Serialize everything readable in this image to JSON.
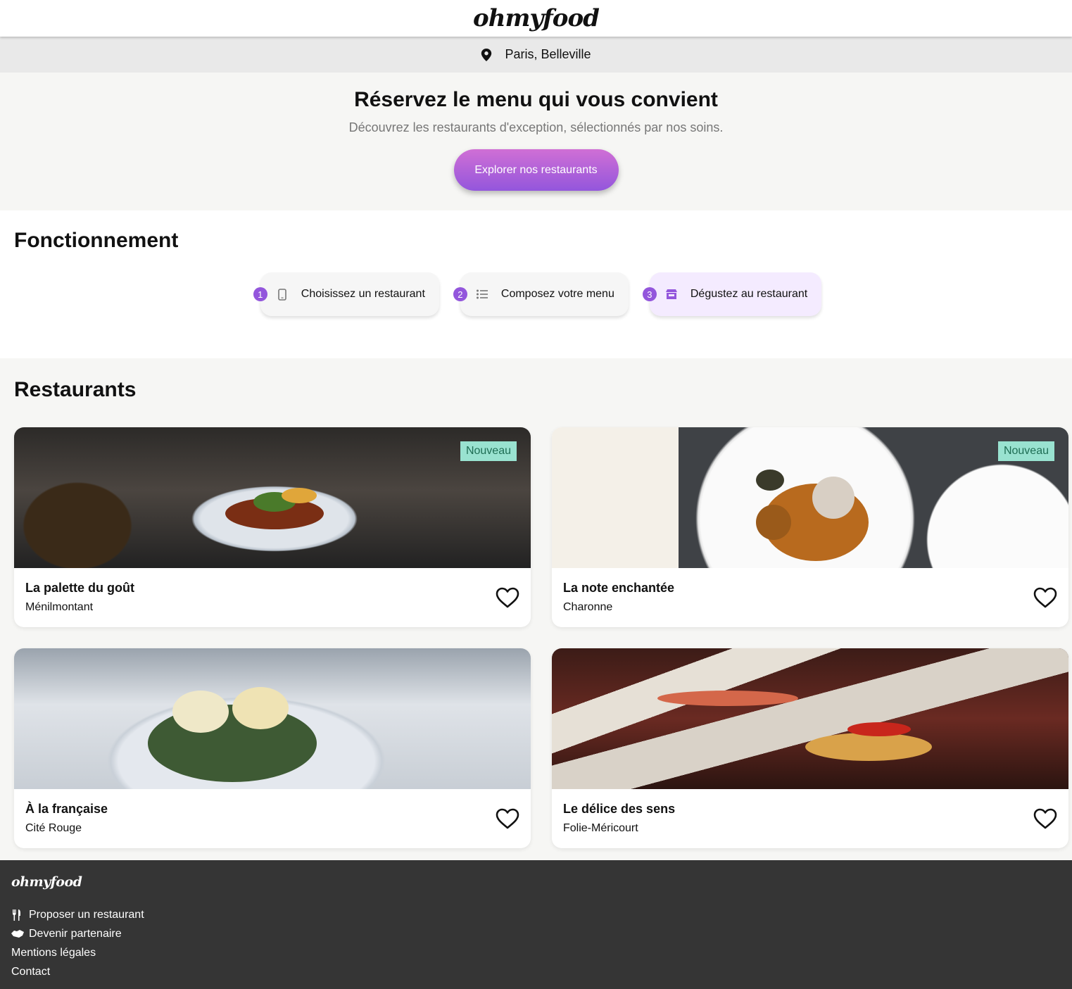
{
  "header": {
    "logo": "ohmyfood"
  },
  "location": {
    "icon": "map-pin-icon",
    "label": "Paris, Belleville"
  },
  "hero": {
    "title": "Réservez le menu qui vous convient",
    "subtitle": "Découvrez les restaurants d'exception, sélectionnés par nos soins.",
    "cta_label": "Explorer nos restaurants"
  },
  "how_it_works": {
    "title": "Fonctionnement",
    "steps": [
      {
        "number": "1",
        "icon": "mobile-phone-icon",
        "label": "Choisissez un restaurant"
      },
      {
        "number": "2",
        "icon": "list-icon",
        "label": "Composez votre menu"
      },
      {
        "number": "3",
        "icon": "store-icon",
        "label": "Dégustez au restaurant"
      }
    ]
  },
  "restaurants": {
    "title": "Restaurants",
    "items": [
      {
        "name": "La palette du goût",
        "district": "Ménilmontant",
        "badge": "Nouveau"
      },
      {
        "name": "La note enchantée",
        "district": "Charonne",
        "badge": "Nouveau"
      },
      {
        "name": "À la française",
        "district": "Cité Rouge",
        "badge": ""
      },
      {
        "name": "Le délice des sens",
        "district": "Folie-Méricourt",
        "badge": ""
      }
    ]
  },
  "footer": {
    "logo": "ohmyfood",
    "links": [
      {
        "icon": "utensils-icon",
        "label": "Proposer un restaurant"
      },
      {
        "icon": "handshake-icon",
        "label": "Devenir partenaire"
      },
      {
        "icon": "",
        "label": "Mentions légales"
      },
      {
        "icon": "",
        "label": "Contact"
      }
    ]
  },
  "colors": {
    "accent_start": "#d06fd5",
    "accent_end": "#9356dc",
    "badge_bg": "#99e2d0",
    "footer_bg": "#353535"
  }
}
